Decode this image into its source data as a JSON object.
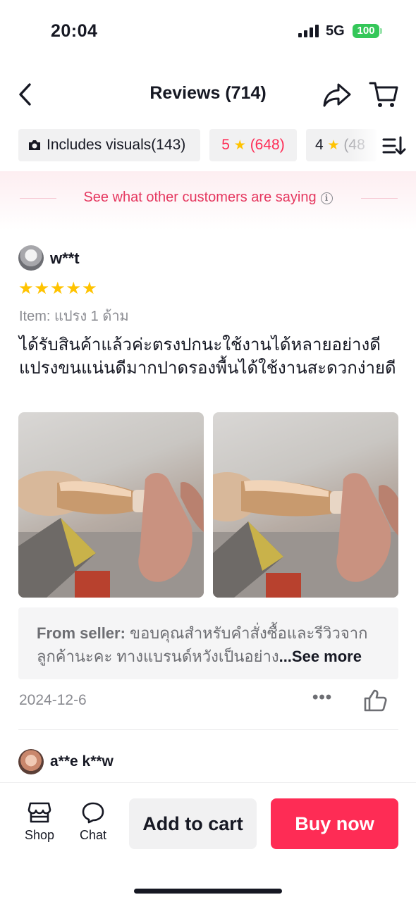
{
  "status_bar": {
    "time": "20:04",
    "network": "5G",
    "battery": "100"
  },
  "nav": {
    "title": "Reviews (714)"
  },
  "filters": {
    "visuals": "Includes visuals(143)",
    "five_star": {
      "rating": "5",
      "count": "(648)"
    },
    "four_star": {
      "rating": "4",
      "count": "(48"
    }
  },
  "banner": {
    "text": "See what other customers are saying"
  },
  "reviews": [
    {
      "username": "w**t",
      "stars": "★★★★★",
      "variant": "Item: แปรง 1 ด้าม",
      "text": "ได้รับสินค้าแล้วค่ะตรงปกนะใช้งานได้หลายอย่างดี แปรงขนแน่นดีมากปาดรองพื้นได้ใช้งานสะดวกง่ายดี",
      "seller_label": "From seller:",
      "seller_reply": " ขอบคุณสำหรับคำสั่งซื้อและรีวิวจากลูกค้านะคะ ทางแบรนด์หวังเป็นอย่าง",
      "see_more": "...See more",
      "date": "2024-12-6",
      "more": "•••"
    },
    {
      "username": "a**e k**w"
    }
  ],
  "bottom_bar": {
    "shop": "Shop",
    "chat": "Chat",
    "add_to_cart": "Add to cart",
    "buy_now": "Buy now"
  },
  "colors": {
    "accent": "#fe2c55",
    "star": "#ffc300",
    "battery": "#34c759",
    "banner_text": "#e5375f"
  }
}
